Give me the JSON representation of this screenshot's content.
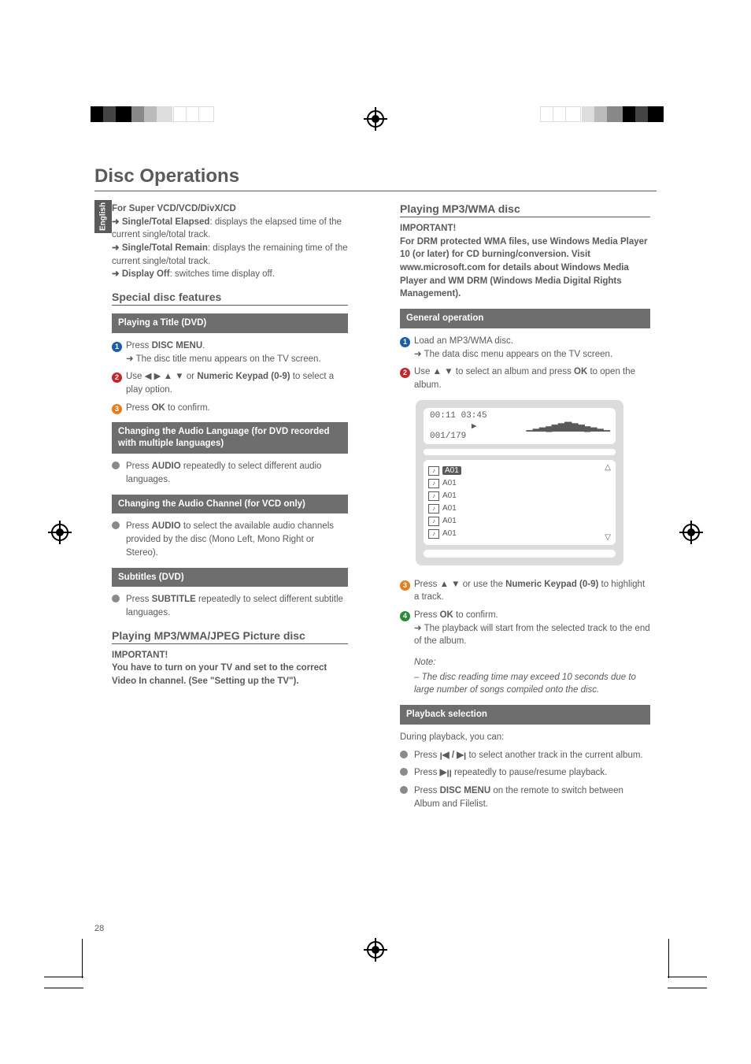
{
  "page": {
    "title": "Disc Operations",
    "language_tab": "English",
    "page_number": "28"
  },
  "left": {
    "svcd_heading": "For Super VCD/VCD/DivX/CD",
    "svcd_l1_pre": "➜ ",
    "svcd_l1_bold": "Single/Total Elapsed",
    "svcd_l1_rest": ": displays the elapsed time of the current single/total track.",
    "svcd_l2_pre": "➜ ",
    "svcd_l2_bold": "Single/Total Remain",
    "svcd_l2_rest": ": displays the remaining time of the current single/total track.",
    "svcd_l3_pre": "➜ ",
    "svcd_l3_bold": "Display Off",
    "svcd_l3_rest": ": switches time display off.",
    "special_heading": "Special disc features",
    "playing_title_block": "Playing a Title (DVD)",
    "step1_pre": "Press ",
    "step1_bold": "DISC MENU",
    "step1_post": ".",
    "step1_sub": "➜ The disc title menu appears on the TV screen.",
    "step2_pre": "Use ◀ ▶ ▲ ▼    or ",
    "step2_bold": "Numeric Keypad (0-9)",
    "step2_post": " to select a play option.",
    "step3_pre": "Press ",
    "step3_bold": "OK",
    "step3_post": " to confirm.",
    "audio_lang_block": "Changing the Audio Language (for DVD recorded with multiple languages)",
    "audio_lang_pre": "Press ",
    "audio_lang_bold": "AUDIO",
    "audio_lang_post": " repeatedly to select different audio languages.",
    "audio_ch_block": "Changing the Audio Channel  (for VCD only)",
    "audio_ch_pre": "Press ",
    "audio_ch_bold": "AUDIO",
    "audio_ch_post": " to select the available audio channels provided by the disc (Mono Left, Mono Right or Stereo).",
    "subtitles_block": "Subtitles (DVD)",
    "subtitles_pre": "Press ",
    "subtitles_bold": "SUBTITLE",
    "subtitles_post": " repeatedly to select different subtitle languages.",
    "mp3_pic_heading": "Playing MP3/WMA/JPEG Picture disc",
    "important_label": "IMPORTANT!",
    "important_text": "You have to turn on your TV and set to the correct Video In channel. (See \"Setting up the TV\")."
  },
  "right": {
    "mp3_heading": "Playing MP3/WMA disc",
    "important_label": "IMPORTANT!",
    "important_text": "For DRM protected WMA files, use Windows Media Player 10 (or later) for CD burning/conversion. Visit www.microsoft.com for details about Windows Media Player and WM DRM (Windows Media Digital Rights Management).",
    "general_op_block": "General operation",
    "r_step1": "Load an MP3/WMA disc.",
    "r_step1_sub": "➜ The data disc menu appears on the TV screen.",
    "r_step2_pre": "Use ▲ ▼ to select an album and press ",
    "r_step2_bold": "OK",
    "r_step2_post": " to open the album.",
    "panel_time": "00:11  03:45",
    "panel_count": "001/179",
    "panel_play_icon": "▶",
    "panel_items": [
      "A01",
      "A01",
      "A01",
      "A01",
      "A01",
      "A01"
    ],
    "r_step3_pre": "Press ▲ ▼ or use the ",
    "r_step3_bold": "Numeric Keypad (0-9)",
    "r_step3_post": " to highlight a track.",
    "r_step4_pre": "Press ",
    "r_step4_bold": "OK",
    "r_step4_post": " to confirm.",
    "r_step4_sub": "➜ The playback will start from the selected track to the end of the album.",
    "note_label": "Note:",
    "note_text": "–  The disc reading time may exceed 10 seconds due to large number of songs compiled onto the disc.",
    "playback_sel_block": "Playback selection",
    "during_text": "During playback, you can:",
    "pb1_pre": "Press  ",
    "pb1_icons": "ꞁ◀ / ▶ꞁ",
    "pb1_post": " to select another track in the current album.",
    "pb2_pre": "Press  ",
    "pb2_icons": "▶ꞁꞁ",
    "pb2_post": " repeatedly to pause/resume playback.",
    "pb3_pre": "Press ",
    "pb3_bold": "DISC MENU",
    "pb3_post": " on the remote to switch between Album and Filelist."
  }
}
